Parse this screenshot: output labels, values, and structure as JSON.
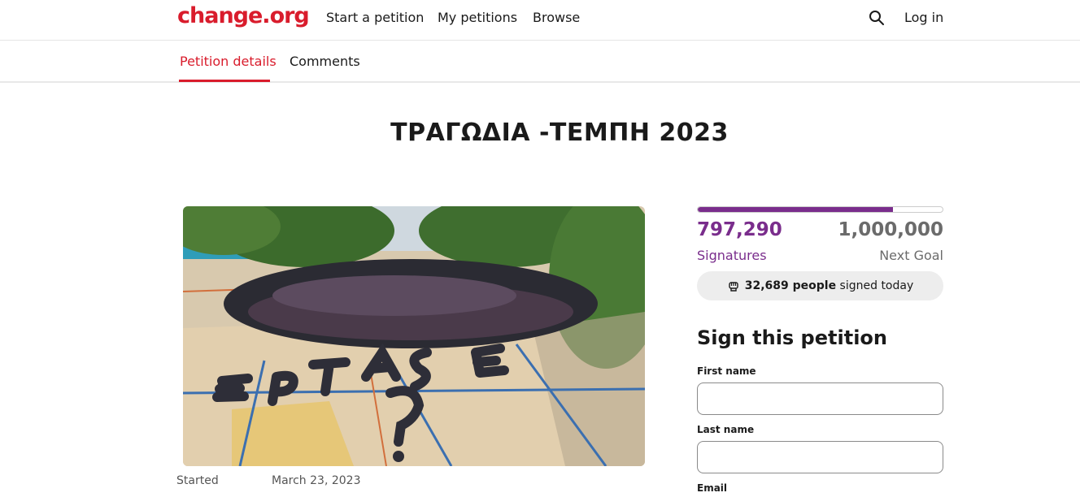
{
  "header": {
    "logo": "change.org",
    "nav": [
      "Start a petition",
      "My petitions",
      "Browse"
    ],
    "login": "Log in",
    "search_icon": "search-icon"
  },
  "tabs": [
    {
      "label": "Petition details",
      "active": true
    },
    {
      "label": "Comments",
      "active": false
    }
  ],
  "petition": {
    "title": "ΤΡΑΓΩΔΙΑ -ΤΕΜΠΗ 2023",
    "started_label": "Started",
    "started_date": "March 23, 2023"
  },
  "progress": {
    "signatures": "797,290",
    "signatures_label": "Signatures",
    "goal": "1,000,000",
    "goal_label": "Next Goal",
    "fraction": 0.797,
    "today_count": "32,689 people",
    "today_suffix": "signed today"
  },
  "form": {
    "heading": "Sign this petition",
    "first_name_label": "First name",
    "last_name_label": "Last name",
    "email_label": "Email",
    "first_name_value": "",
    "last_name_value": "",
    "email_value": ""
  },
  "colors": {
    "brand_red": "#d91c2c",
    "progress_purple": "#7a2d8c",
    "pill_bg": "#ededed"
  }
}
